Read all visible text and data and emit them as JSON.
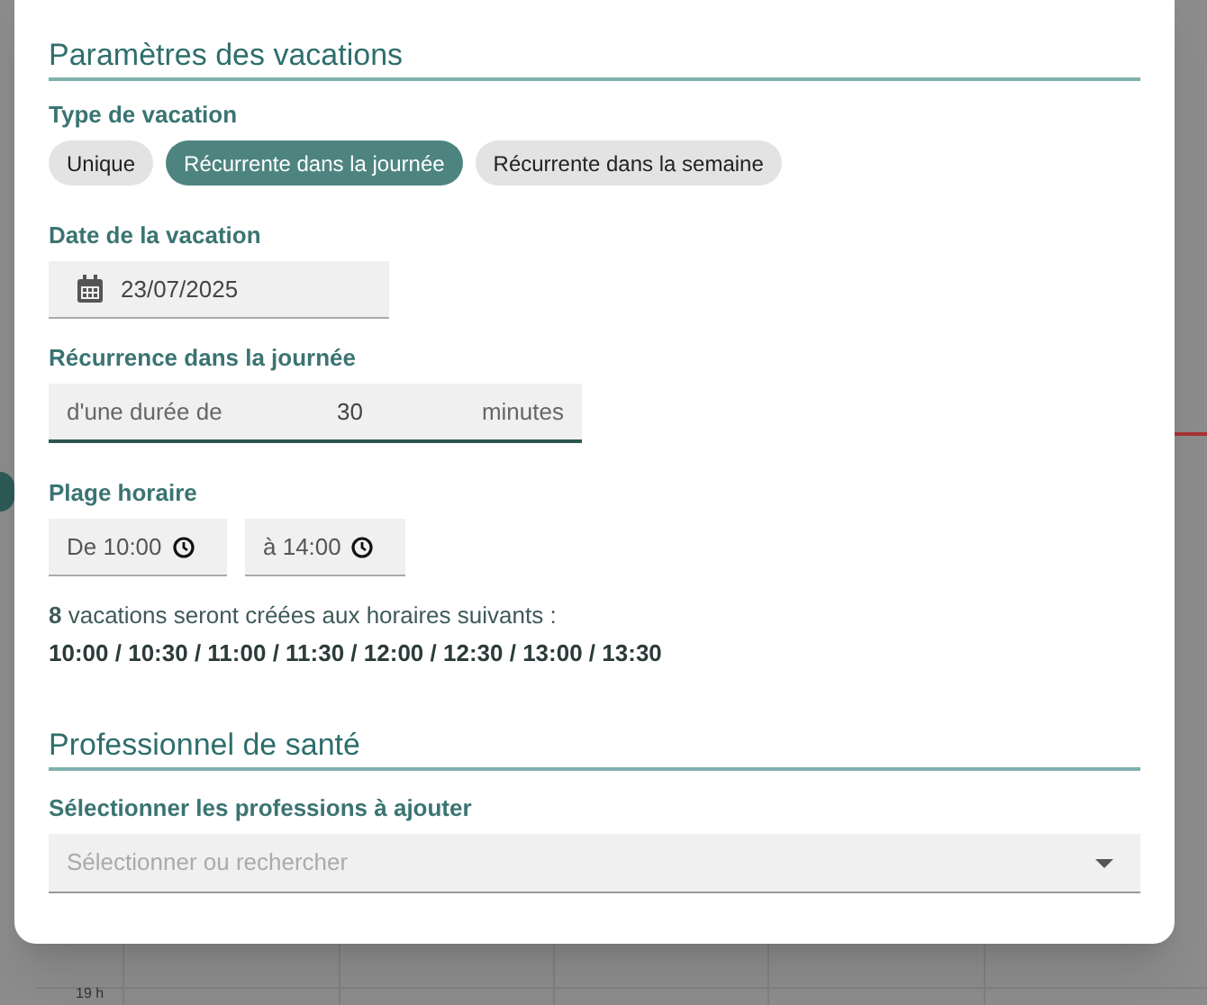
{
  "background": {
    "hour_label": "19 h"
  },
  "modal": {
    "section_1": {
      "title": "Paramètres des vacations"
    },
    "type": {
      "label": "Type de vacation",
      "options": [
        {
          "label": "Unique",
          "selected": false
        },
        {
          "label": "Récurrente dans la journée",
          "selected": true
        },
        {
          "label": "Récurrente dans la semaine",
          "selected": false
        }
      ]
    },
    "date": {
      "label": "Date de la vacation",
      "value": "23/07/2025"
    },
    "recurrence": {
      "label": "Récurrence dans la journée",
      "prefix": "d'une durée de",
      "value": "30",
      "suffix": "minutes"
    },
    "time_range": {
      "label": "Plage horaire",
      "from": "De 10:00",
      "to": "à 14:00"
    },
    "summary": "**8** vacations seront créées aux horaires suivants :",
    "times": "10:00 / 10:30 / 11:00 / 11:30 / 12:00 / 12:30 / 13:00 / 13:30",
    "section_2": {
      "title": "Professionnel de santé"
    },
    "professions": {
      "label": "Sélectionner les professions à ajouter",
      "placeholder": "Sélectionner ou rechercher"
    }
  }
}
